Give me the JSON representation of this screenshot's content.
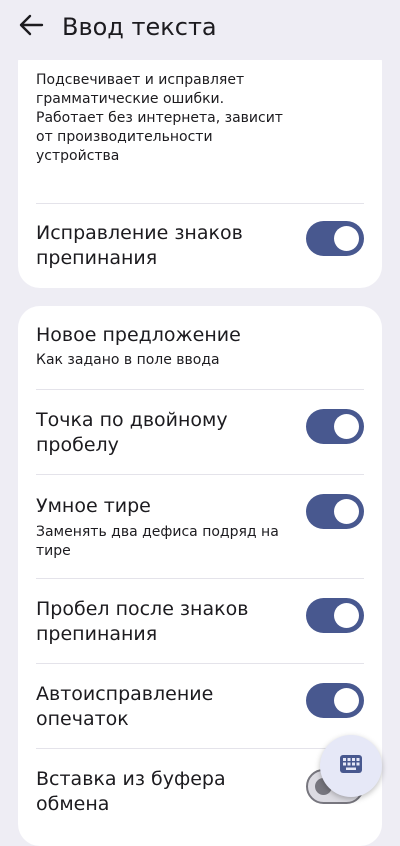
{
  "header": {
    "title": "Ввод текста"
  },
  "card1": {
    "description": "Подсвечивает и исправляет грамматические ошибки. Работает без интернета, зависит от производительности устройства",
    "punctuation_correction": {
      "label": "Исправление знаков препинания",
      "enabled": true
    }
  },
  "card2": {
    "new_sentence": {
      "label": "Новое предложение",
      "summary": "Как задано в поле ввода"
    },
    "double_space_period": {
      "label": "Точка по двойному пробелу",
      "enabled": true
    },
    "smart_dash": {
      "label": "Умное тире",
      "summary": "Заменять два дефиса подряд на тире",
      "enabled": true
    },
    "space_after_punctuation": {
      "label": "Пробел после знаков препинания",
      "enabled": true
    },
    "autocorrect_typos": {
      "label": "Автоисправление опечаток",
      "enabled": true
    },
    "paste_from_clipboard": {
      "label": "Вставка из буфера обмена",
      "enabled": false
    }
  },
  "fab": {
    "icon": "keyboard-icon"
  },
  "colors": {
    "background": "#eeedf4",
    "card": "#ffffff",
    "toggle_on": "#48588f",
    "fab": "#e6e8f7"
  }
}
